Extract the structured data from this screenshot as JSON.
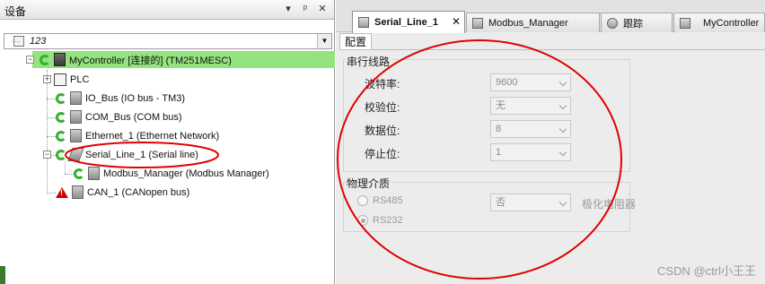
{
  "left_panel": {
    "title": "设备",
    "pin_glyph": "▼ ᵖ",
    "close_glyph": "✕",
    "combo_value": "123",
    "tree": [
      {
        "label": "MyController [连接的] (TM251MESC)"
      },
      {
        "label": "PLC"
      },
      {
        "label": "IO_Bus (IO bus - TM3)"
      },
      {
        "label": "COM_Bus (COM bus)"
      },
      {
        "label": "Ethernet_1 (Ethernet Network)"
      },
      {
        "label": "Serial_Line_1 (Serial line)"
      },
      {
        "label": "Modbus_Manager (Modbus Manager)"
      },
      {
        "label": "CAN_1 (CANopen bus)"
      }
    ]
  },
  "tabs": [
    {
      "label": "Serial_Line_1",
      "active": true,
      "close": "✕"
    },
    {
      "label": "Modbus_Manager",
      "active": false
    },
    {
      "label": "跟踪",
      "active": false
    },
    {
      "label": "MyController",
      "active": false
    }
  ],
  "subtab": "配置",
  "serial_group": {
    "title": "串行线路",
    "fields": [
      {
        "label": "波特率:",
        "value": "9600"
      },
      {
        "label": "校验位:",
        "value": "无"
      },
      {
        "label": "数据位:",
        "value": "8"
      },
      {
        "label": "停止位:",
        "value": "1"
      }
    ]
  },
  "physical_group": {
    "title": "物理介质",
    "rs485": "RS485",
    "rs232": "RS232",
    "termination_value": "否",
    "termination_label": "极化电阻器"
  },
  "watermark": "CSDN @ctrl小王王",
  "colors": {
    "selected_row": "#93e37e",
    "annotation_red": "#e00000",
    "status_green": "#35b12a"
  }
}
